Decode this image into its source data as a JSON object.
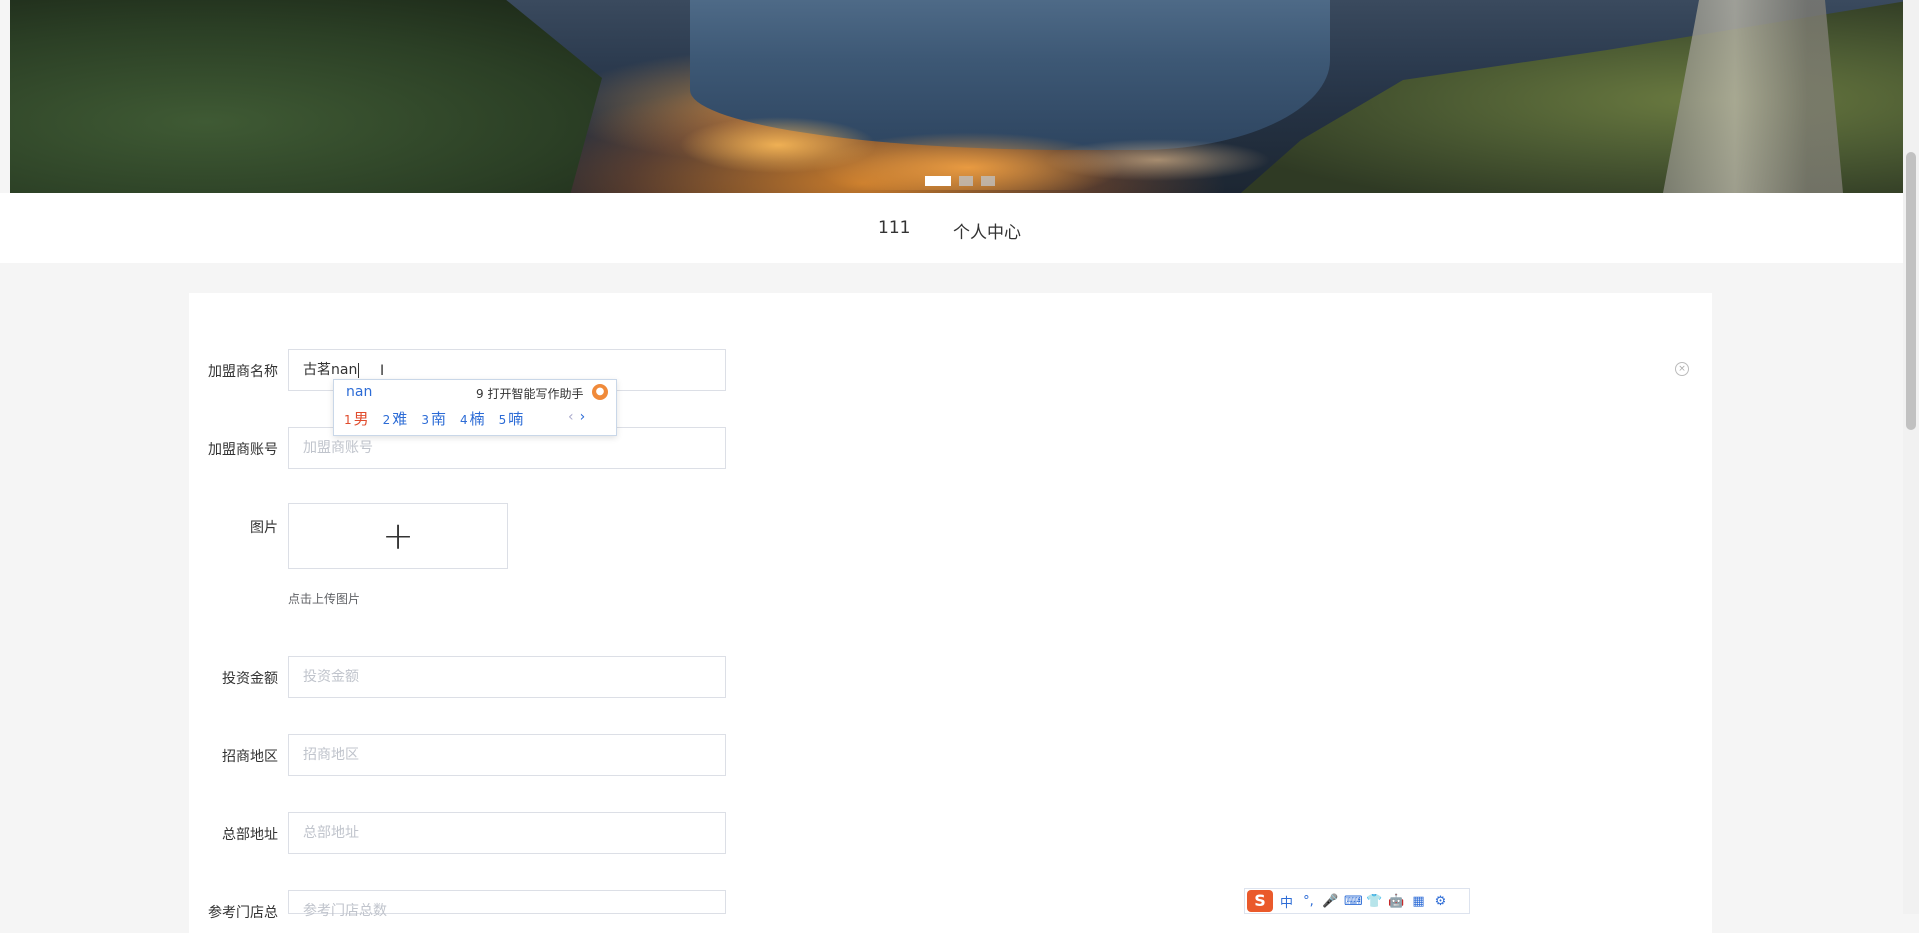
{
  "nav": {
    "items": [
      "111",
      "个人中心"
    ]
  },
  "form": {
    "fields": [
      {
        "label": "加盟商名称",
        "value": "古茗nan",
        "placeholder": ""
      },
      {
        "label": "加盟商账号",
        "value": "",
        "placeholder": "加盟商账号"
      },
      {
        "label": "投资金额",
        "value": "",
        "placeholder": "投资金额"
      },
      {
        "label": "招商地区",
        "value": "",
        "placeholder": "招商地区"
      },
      {
        "label": "总部地址",
        "value": "",
        "placeholder": "总部地址"
      },
      {
        "label": "参考门店总",
        "value": "",
        "placeholder": "参考门店总数"
      }
    ],
    "image_label": "图片",
    "upload_plus": "+",
    "upload_hint": "点击上传图片"
  },
  "ime": {
    "composition": "nan",
    "assistant": "9 打开智能写作助手",
    "candidates": [
      {
        "num": "1",
        "text": "男"
      },
      {
        "num": "2",
        "text": "难"
      },
      {
        "num": "3",
        "text": "南"
      },
      {
        "num": "4",
        "text": "楠"
      },
      {
        "num": "5",
        "text": "喃"
      }
    ],
    "prev": "‹",
    "next": "›"
  },
  "ime_toolbar": {
    "logo": "S",
    "items": [
      "中",
      "°,",
      "🎤",
      "⌨",
      "👕",
      "🤖",
      "▦",
      "⚙"
    ]
  }
}
